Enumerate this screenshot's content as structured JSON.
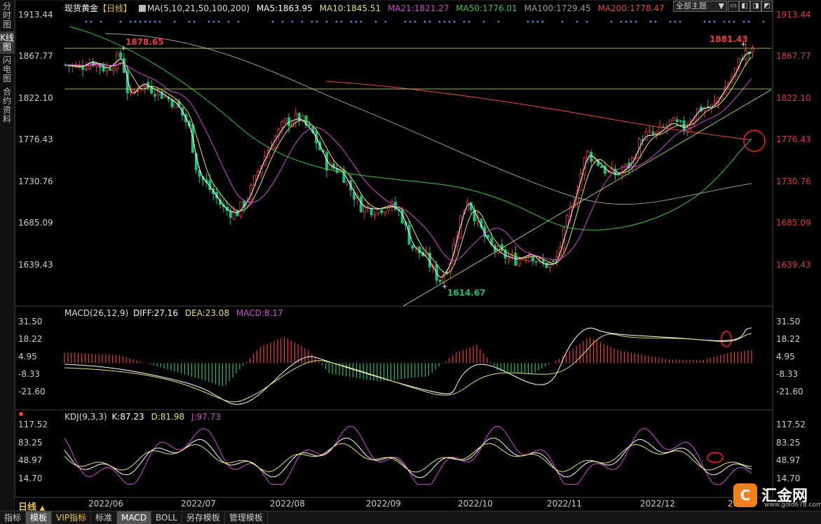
{
  "leftbar": {
    "items": [
      {
        "label": "分时图",
        "active": false
      },
      {
        "label": "K线图",
        "active": true
      },
      {
        "label": "闪电图",
        "active": false
      },
      {
        "label": "合约资料",
        "active": false
      }
    ]
  },
  "header": {
    "symbol": "现货黄金",
    "period": "【日线】",
    "ma_label": "MA(5,10,21,50,100,200)",
    "ma5": "MA5:1863.95",
    "ma10": "MA10:1845.51",
    "ma21": "MA21:1821.27",
    "ma50": "MA50:1776.01",
    "ma100": "MA100:1729.45",
    "ma200": "MA200:1778.47"
  },
  "toolbar": {
    "theme": "全部主题",
    "theme_arrow": "▼",
    "buttons": [
      "▭",
      "◧",
      "◨",
      "◩",
      "⊠"
    ]
  },
  "colors": {
    "up": "#f03c3c",
    "down": "#19c27a",
    "ma5": "#ffffff",
    "ma10": "#e6e36a",
    "ma21": "#d34ad3",
    "ma50": "#37c837",
    "ma100": "#9a9a9a",
    "ma200": "#e34a3a"
  },
  "price_axis": {
    "ticks": [
      "1913.44",
      "1867.77",
      "1822.10",
      "1776.43",
      "1730.76",
      "1685.09",
      "1639.43"
    ]
  },
  "annotations": {
    "high_left": "1878.65",
    "high_right": "1881.43",
    "low": "1614.67"
  },
  "macd": {
    "label": "MACD(26,12,9)",
    "diff": "DIFF:27.16",
    "dea": "DEA:23.08",
    "macd": "MACD:8.17",
    "ticks": [
      "31.50",
      "18.22",
      "4.95",
      "-8.33",
      "-21.60"
    ]
  },
  "kdj": {
    "label": "KDJ(9,3,3)",
    "k": "K:87.23",
    "d": "D:81.98",
    "j": "J:97.73",
    "ticks": [
      "117.52",
      "83.25",
      "48.97",
      "14.70"
    ]
  },
  "x_axis": {
    "labels": [
      "2022/06",
      "2022/07",
      "2022/08",
      "2022/09",
      "2022/10",
      "2022/11",
      "2022/12",
      "20"
    ]
  },
  "period_button": {
    "label": "日线",
    "arrow": "▲"
  },
  "bottom_tabs": [
    {
      "label": "指标",
      "active": false,
      "vip": false
    },
    {
      "label": "模板",
      "active": true,
      "vip": false
    },
    {
      "label": "VIP指标",
      "active": false,
      "vip": true
    },
    {
      "label": "标准",
      "active": false,
      "vip": false
    },
    {
      "label": "MACD",
      "active": true,
      "vip": false
    },
    {
      "label": "BOLL",
      "active": false,
      "vip": false
    },
    {
      "label": "另存模板",
      "active": false,
      "vip": false
    },
    {
      "label": "管理模板",
      "active": false,
      "vip": false
    }
  ],
  "logo": {
    "mark": "C",
    "name": "汇金网",
    "url": "www.gold678.com"
  }
}
